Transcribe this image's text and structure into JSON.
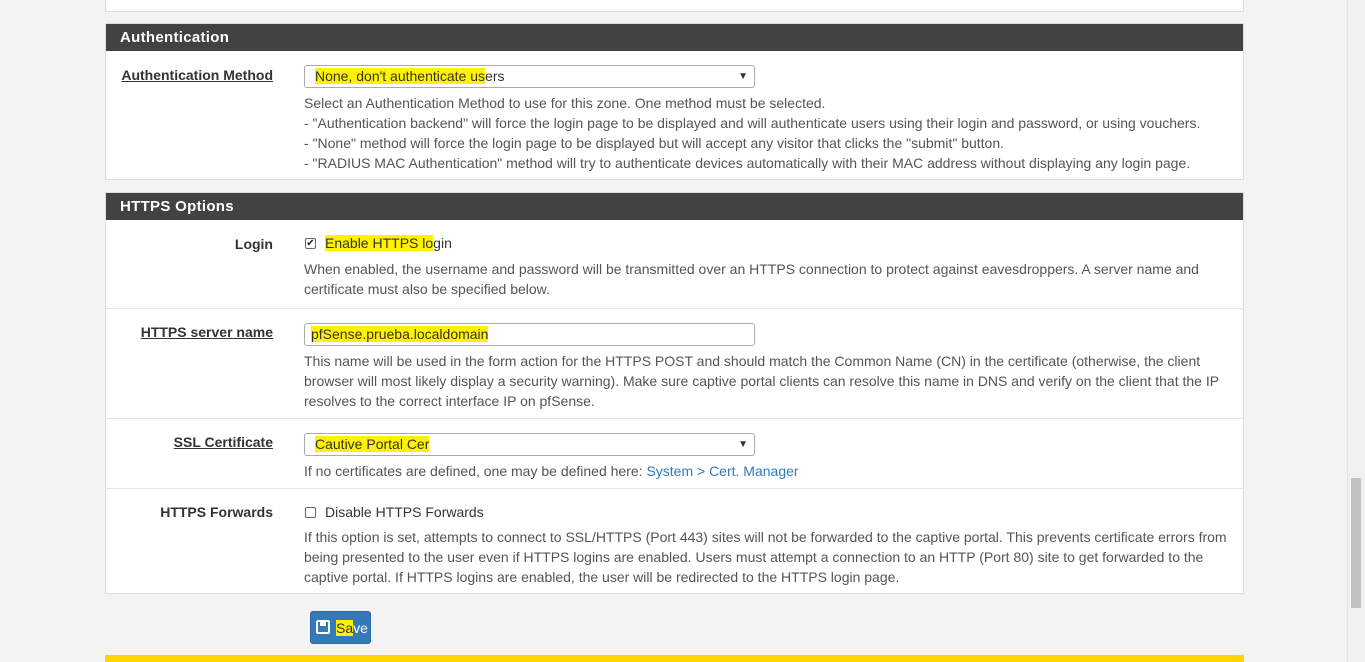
{
  "auth": {
    "header": "Authentication",
    "method_label": "Authentication Method",
    "method_value_hl": "None, don't authenticate us",
    "method_value_rest": "ers",
    "help": [
      "Select an Authentication Method to use for this zone. One method must be selected.",
      "- \"Authentication backend\" will force the login page to be displayed and will authenticate users using their login and password, or using vouchers.",
      "- \"None\" method will force the login page to be displayed but will accept any visitor that clicks the \"submit\" button.",
      "- \"RADIUS MAC Authentication\" method will try to authenticate devices automatically with their MAC address without displaying any login page."
    ]
  },
  "https": {
    "header": "HTTPS Options",
    "login_label": "Login",
    "login_checked": true,
    "login_cb_label_hl": "Enable HTTPS lo",
    "login_cb_label_rest": "gin",
    "login_help": "When enabled, the username and password will be transmitted over an HTTPS connection to protect against eavesdroppers. A server name and certificate must also be specified below.",
    "server_label": "HTTPS server name",
    "server_value": "pfSense.prueba.localdomain",
    "server_help": "This name will be used in the form action for the HTTPS POST and should match the Common Name (CN) in the certificate (otherwise, the client browser will most likely display a security warning). Make sure captive portal clients can resolve this name in DNS and verify on the client that the IP resolves to the correct interface IP on pfSense.",
    "ssl_label": "SSL Certificate",
    "ssl_value": "Cautive Portal Cer",
    "ssl_help_prefix": "If no certificates are defined, one may be defined here: ",
    "ssl_help_link": "System > Cert. Manager",
    "fwd_label": "HTTPS Forwards",
    "fwd_checked": false,
    "fwd_cb_label": "Disable HTTPS Forwards",
    "fwd_help": "If this option is set, attempts to connect to SSL/HTTPS (Port 443) sites will not be forwarded to the captive portal. This prevents certificate errors from being presented to the user even if HTTPS logins are enabled. Users must attempt a connection to an HTTP (Port 80) site to get forwarded to the captive portal. If HTTPS logins are enabled, the user will be redirected to the HTTPS login page."
  },
  "save": {
    "label_hl": "Sa",
    "label_rest": "ve"
  },
  "colors": {
    "header_bg": "#424242",
    "highlight": "#fff200",
    "primary": "#337ab7"
  }
}
